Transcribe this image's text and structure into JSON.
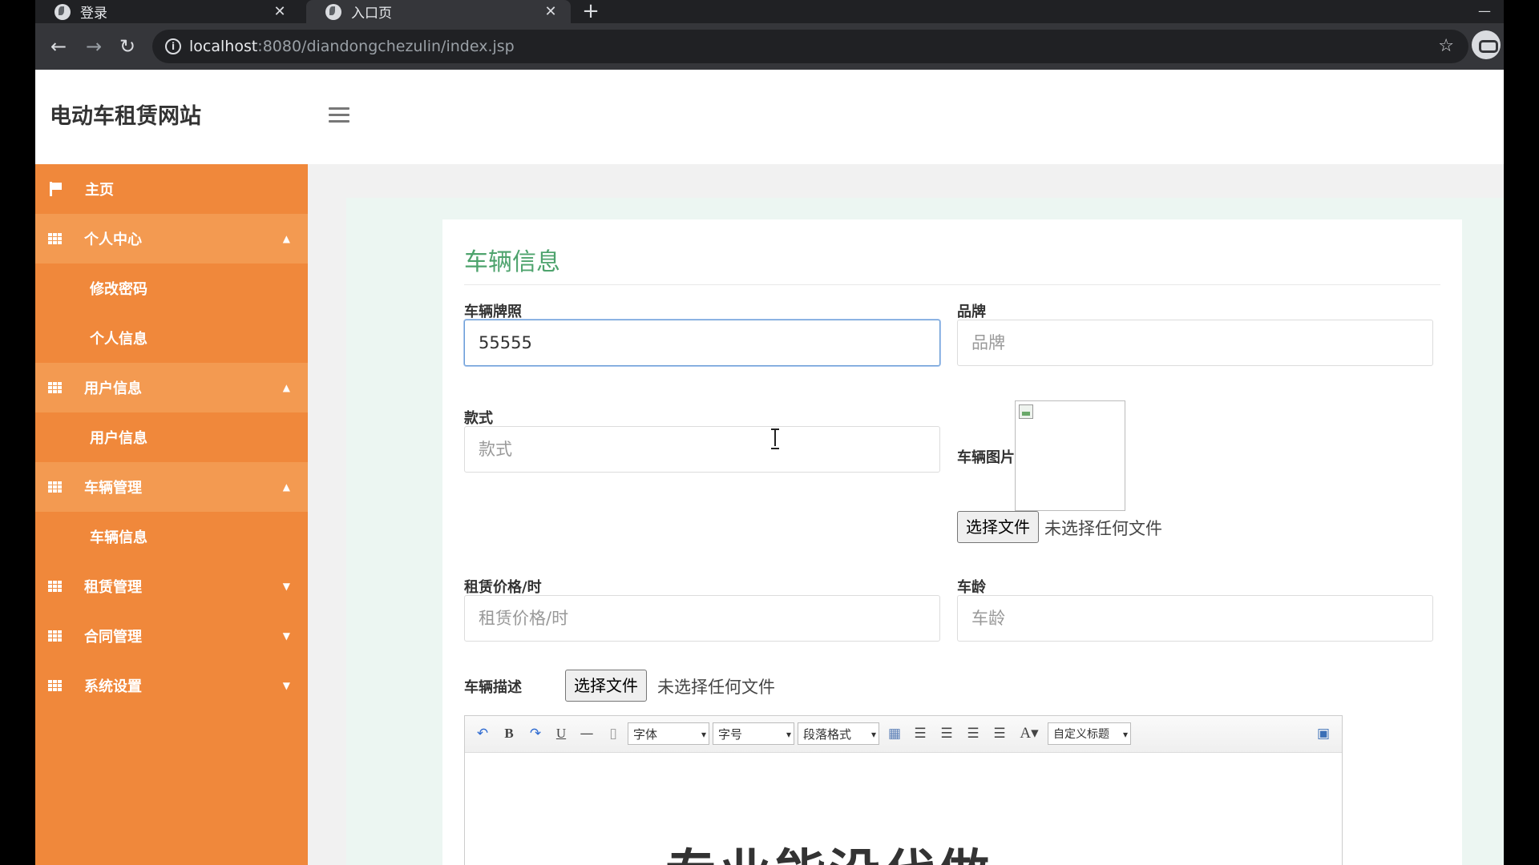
{
  "browser": {
    "tabs": [
      {
        "title": "登录",
        "active": false
      },
      {
        "title": "入口页",
        "active": true
      }
    ],
    "url_host": "localhost",
    "url_path": ":8080/diandongchezulin/index.jsp"
  },
  "app": {
    "brand": "电动车租赁网站"
  },
  "sidebar": {
    "home": "主页",
    "personal_center": "个人中心",
    "change_password": "修改密码",
    "personal_info": "个人信息",
    "user_info": "用户信息",
    "user_info_sub": "用户信息",
    "vehicle_mgmt": "车辆管理",
    "vehicle_info": "车辆信息",
    "rental_mgmt": "租赁管理",
    "contract_mgmt": "合同管理",
    "system_settings": "系统设置"
  },
  "form": {
    "title": "车辆信息",
    "plate_label": "车辆牌照",
    "plate_value": "55555",
    "brand_label": "品牌",
    "brand_placeholder": "品牌",
    "style_label": "款式",
    "style_placeholder": "款式",
    "image_label": "车辆图片",
    "choose_file": "选择文件",
    "no_file": "未选择任何文件",
    "price_label": "租赁价格/时",
    "price_placeholder": "租赁价格/时",
    "age_label": "车龄",
    "age_placeholder": "车龄",
    "desc_label": "车辆描述",
    "desc_choose_file": "选择文件",
    "desc_no_file": "未选择任何文件"
  },
  "editor": {
    "font_select": "字体",
    "size_select": "字号",
    "para_select": "段落格式",
    "custom_title_select": "自定义标题",
    "content_text": "专业能没代做"
  }
}
